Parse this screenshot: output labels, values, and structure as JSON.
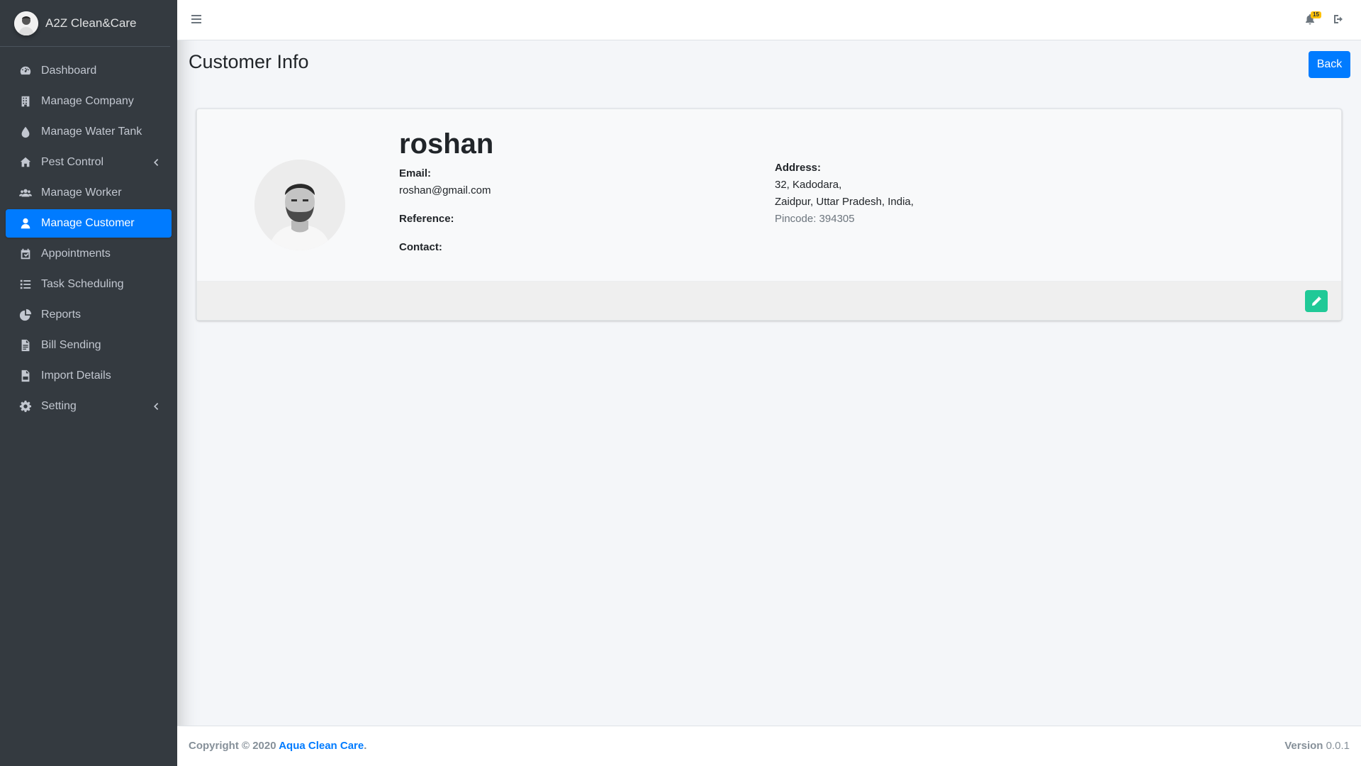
{
  "brand": {
    "title": "A2Z Clean&Care"
  },
  "sidebar": {
    "items": [
      {
        "label": "Dashboard",
        "icon": "dashboard-icon"
      },
      {
        "label": "Manage Company",
        "icon": "building-icon"
      },
      {
        "label": "Manage Water Tank",
        "icon": "water-drop-icon"
      },
      {
        "label": "Pest Control",
        "icon": "home-icon",
        "has_submenu": true
      },
      {
        "label": "Manage Worker",
        "icon": "users-icon"
      },
      {
        "label": "Manage Customer",
        "icon": "user-icon",
        "active": true
      },
      {
        "label": "Appointments",
        "icon": "calendar-check-icon"
      },
      {
        "label": "Task Scheduling",
        "icon": "tasks-icon"
      },
      {
        "label": "Reports",
        "icon": "chart-pie-icon"
      },
      {
        "label": "Bill Sending",
        "icon": "file-invoice-icon"
      },
      {
        "label": "Import Details",
        "icon": "file-csv-icon"
      },
      {
        "label": "Setting",
        "icon": "gear-icon",
        "has_submenu": true
      }
    ]
  },
  "topbar": {
    "notification_count": "15"
  },
  "page": {
    "title": "Customer Info",
    "back_label": "Back"
  },
  "customer": {
    "name": "roshan",
    "email_label": "Email:",
    "email": "roshan@gmail.com",
    "reference_label": "Reference:",
    "contact_label": "Contact:",
    "address_label": "Address:",
    "address_line1": "32, Kadodara,",
    "address_line2": "Zaidpur, Uttar Pradesh, India,",
    "pincode": "Pincode: 394305"
  },
  "footer": {
    "copyright_prefix": "Copyright © 2020 ",
    "company": "Aqua Clean Care",
    "copyright_suffix": ".",
    "version_label": "Version",
    "version": "0.0.1"
  },
  "colors": {
    "sidebar_bg": "#343a40",
    "accent": "#007bff",
    "edit_button": "#20c997",
    "badge": "#ffc107"
  }
}
